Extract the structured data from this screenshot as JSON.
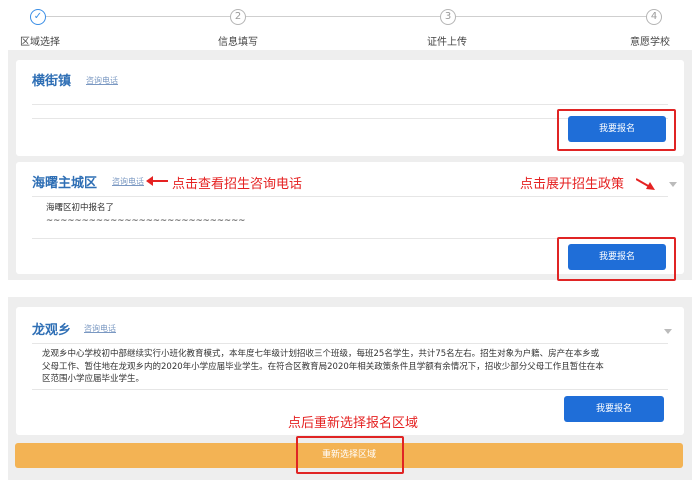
{
  "stepper": {
    "steps": [
      {
        "label": "区域选择",
        "number": "✓"
      },
      {
        "label": "信息填写",
        "number": "2"
      },
      {
        "label": "证件上传",
        "number": "3"
      },
      {
        "label": "意愿学校",
        "number": "4"
      }
    ]
  },
  "cards": [
    {
      "title": "横街镇",
      "phone": "咨询电话",
      "apply": "我要报名"
    },
    {
      "title": "海曙主城区",
      "phone": "咨询电话",
      "body_line1": "海曙区初中报名了",
      "body_line2": "~~~~~~~~~~~~~~~~~~~~~~~~~~~~",
      "apply": "我要报名"
    },
    {
      "title": "龙观乡",
      "phone": "咨询电话",
      "body_line1": "龙观乡中心学校初中部继续实行小班化教育模式，本年度七年级计划招收三个班级，每班25名学生，共计75名左右。招生对象为户籍、房产在本乡或",
      "body_line2": "父母工作、暂住地在龙观乡内的2020年小学应届毕业学生。在符合区教育局2020年相关政策条件且学额有余情况下，招收少部分父母工作且暂住在本",
      "body_line3": "区范围小学应届毕业学生。",
      "apply": "我要报名"
    }
  ],
  "annotations": {
    "view_phone": "点击查看招生咨询电话",
    "expand_policy": "点击展开招生政策",
    "reselect_hint": "点后重新选择报名区域"
  },
  "reselect": {
    "label": "重新选择区域"
  },
  "colors": {
    "primary": "#1f6ed8",
    "title": "#2f6fb5",
    "highlight": "#e02424",
    "orange": "#f3b354"
  }
}
